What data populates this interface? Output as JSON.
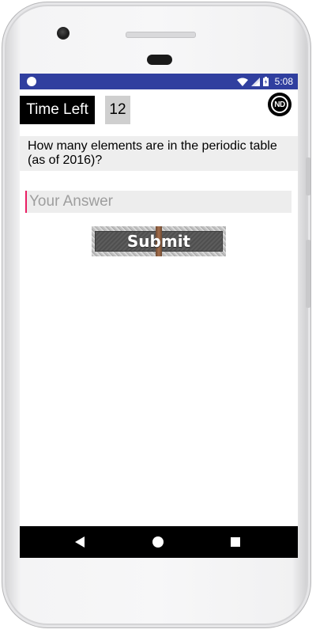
{
  "status_bar": {
    "time": "5:08",
    "icons": [
      "notification-dot-icon",
      "wifi-icon",
      "signal-icon",
      "battery-icon"
    ],
    "color": "#303f9f"
  },
  "timer": {
    "label": "Time Left",
    "value": "12"
  },
  "logo": {
    "text": "ND"
  },
  "question": {
    "text": "How many elements are in the periodic table (as of 2016)?"
  },
  "answer": {
    "placeholder": "Your Answer",
    "value": ""
  },
  "submit": {
    "label": "Submit"
  },
  "nav_bar": {
    "icons": [
      "back-icon",
      "home-icon",
      "recents-icon"
    ]
  }
}
